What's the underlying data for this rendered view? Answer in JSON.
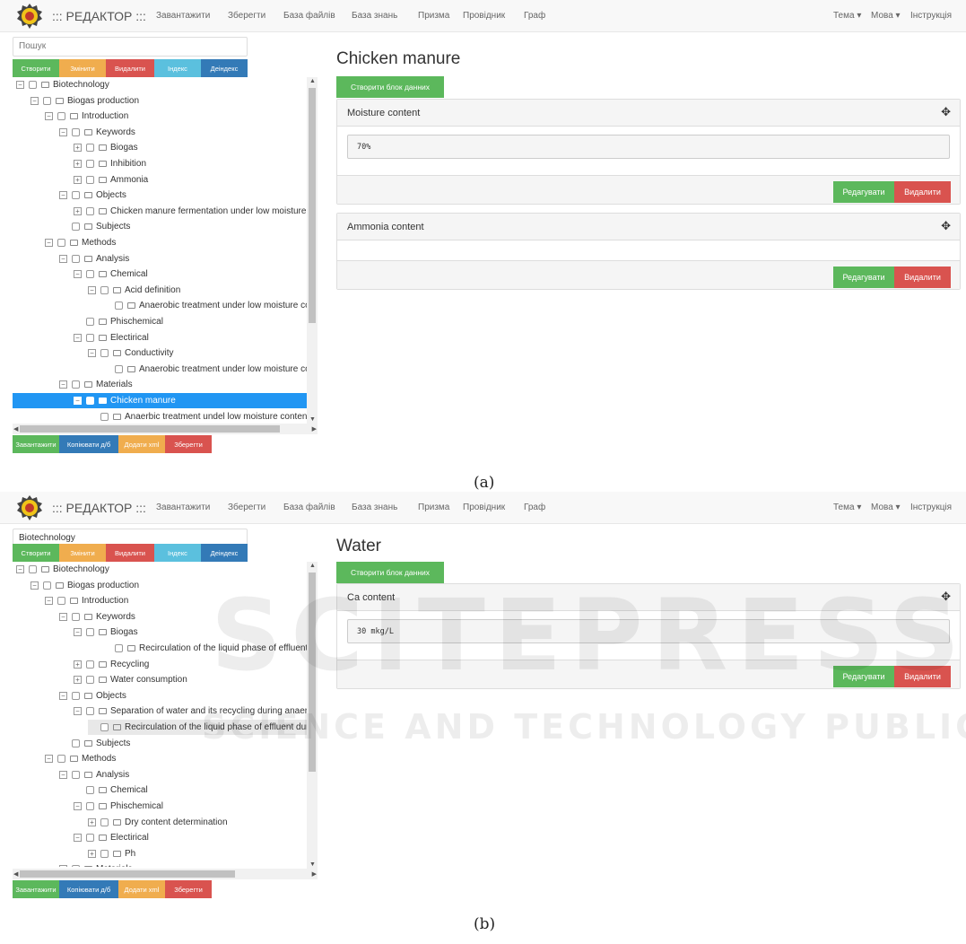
{
  "navbar": {
    "brand": "::: РЕДАКТОР :::",
    "items": [
      "Завантажити",
      "Зберегти",
      "База файлів",
      "База знань",
      "Призма",
      "Провідник",
      "Граф"
    ],
    "right_items": [
      "Тема ▾",
      "Мова ▾",
      "Інструкція"
    ]
  },
  "toolbar_top": [
    "Створити",
    "Змінити",
    "Видалити",
    "Індекс",
    "Деіндекс"
  ],
  "toolbar_bottom": [
    "Завантажити",
    "Копіювати д/б",
    "Додати xml",
    "Зберегти"
  ],
  "create_block_label": "Створити блок данних",
  "edit_label": "Редагувати",
  "delete_label": "Видалити",
  "panel_a": {
    "caption": "(a)",
    "search_placeholder": "Пошук",
    "title": "Chicken manure",
    "blocks": [
      {
        "title": "Moisture content",
        "value": "70%"
      },
      {
        "title": "Ammonia content",
        "value": ""
      }
    ],
    "tree": [
      {
        "label": "Biotechnology",
        "level": 0,
        "toggle": "minus"
      },
      {
        "label": "Biogas production",
        "level": 1,
        "toggle": "minus"
      },
      {
        "label": "Introduction",
        "level": 2,
        "toggle": "minus"
      },
      {
        "label": "Keywords",
        "level": 3,
        "toggle": "minus"
      },
      {
        "label": "Biogas",
        "level": 4,
        "toggle": "plus"
      },
      {
        "label": "Inhibition",
        "level": 4,
        "toggle": "plus"
      },
      {
        "label": "Ammonia",
        "level": 4,
        "toggle": "plus"
      },
      {
        "label": "Objects",
        "level": 3,
        "toggle": "minus"
      },
      {
        "label": "Chicken manure fermentation under low moisture",
        "level": 4,
        "toggle": "plus"
      },
      {
        "label": "Subjects",
        "level": 3,
        "toggle": "none"
      },
      {
        "label": "Methods",
        "level": 2,
        "toggle": "minus"
      },
      {
        "label": "Analysis",
        "level": 3,
        "toggle": "minus"
      },
      {
        "label": "Chemical",
        "level": 4,
        "toggle": "minus"
      },
      {
        "label": "Acid definition",
        "level": 5,
        "toggle": "minus"
      },
      {
        "label": "Anaerobic treatment under low moisture co",
        "level": 6,
        "toggle": "none"
      },
      {
        "label": "Phischemical",
        "level": 4,
        "toggle": "none"
      },
      {
        "label": "Electirical",
        "level": 4,
        "toggle": "minus"
      },
      {
        "label": "Conductivity",
        "level": 5,
        "toggle": "minus"
      },
      {
        "label": "Anaerobic treatment under low moisture co",
        "level": 6,
        "toggle": "none"
      },
      {
        "label": "Materials",
        "level": 3,
        "toggle": "minus"
      },
      {
        "label": "Chicken manure",
        "level": 4,
        "toggle": "minus",
        "selected": true
      },
      {
        "label": "Anaerbic treatment undel low moisture content",
        "level": 5,
        "toggle": "none"
      }
    ]
  },
  "panel_b": {
    "caption": "(b)",
    "search_value": "Biotechnology",
    "title": "Water",
    "blocks": [
      {
        "title": "Ca content",
        "value": "30 mkg/L"
      }
    ],
    "tree": [
      {
        "label": "Biotechnology",
        "level": 0,
        "toggle": "minus"
      },
      {
        "label": "Biogas production",
        "level": 1,
        "toggle": "minus"
      },
      {
        "label": "Introduction",
        "level": 2,
        "toggle": "minus"
      },
      {
        "label": "Keywords",
        "level": 3,
        "toggle": "minus"
      },
      {
        "label": "Biogas",
        "level": 4,
        "toggle": "minus"
      },
      {
        "label": "Recirculation of the liquid phase of effluent duri",
        "level": 6,
        "toggle": "none"
      },
      {
        "label": "Recycling",
        "level": 4,
        "toggle": "plus"
      },
      {
        "label": "Water consumption",
        "level": 4,
        "toggle": "plus"
      },
      {
        "label": "Objects",
        "level": 3,
        "toggle": "minus"
      },
      {
        "label": "Separation of water and its recycling during anaerc",
        "level": 4,
        "toggle": "minus"
      },
      {
        "label": "Recirculation of the liquid phase of effluent duri",
        "level": 5,
        "toggle": "none",
        "hover": true
      },
      {
        "label": "Subjects",
        "level": 3,
        "toggle": "none"
      },
      {
        "label": "Methods",
        "level": 2,
        "toggle": "minus"
      },
      {
        "label": "Analysis",
        "level": 3,
        "toggle": "minus"
      },
      {
        "label": "Chemical",
        "level": 4,
        "toggle": "none"
      },
      {
        "label": "Phischemical",
        "level": 4,
        "toggle": "minus"
      },
      {
        "label": "Dry content determination",
        "level": 5,
        "toggle": "plus"
      },
      {
        "label": "Electirical",
        "level": 4,
        "toggle": "minus"
      },
      {
        "label": "Ph",
        "level": 5,
        "toggle": "plus"
      },
      {
        "label": "Materials",
        "level": 3,
        "toggle": "minus"
      }
    ]
  },
  "watermark": {
    "line1": "SCITEPRESS",
    "line2": "SCIENCE AND TECHNOLOGY PUBLICATIONS"
  }
}
